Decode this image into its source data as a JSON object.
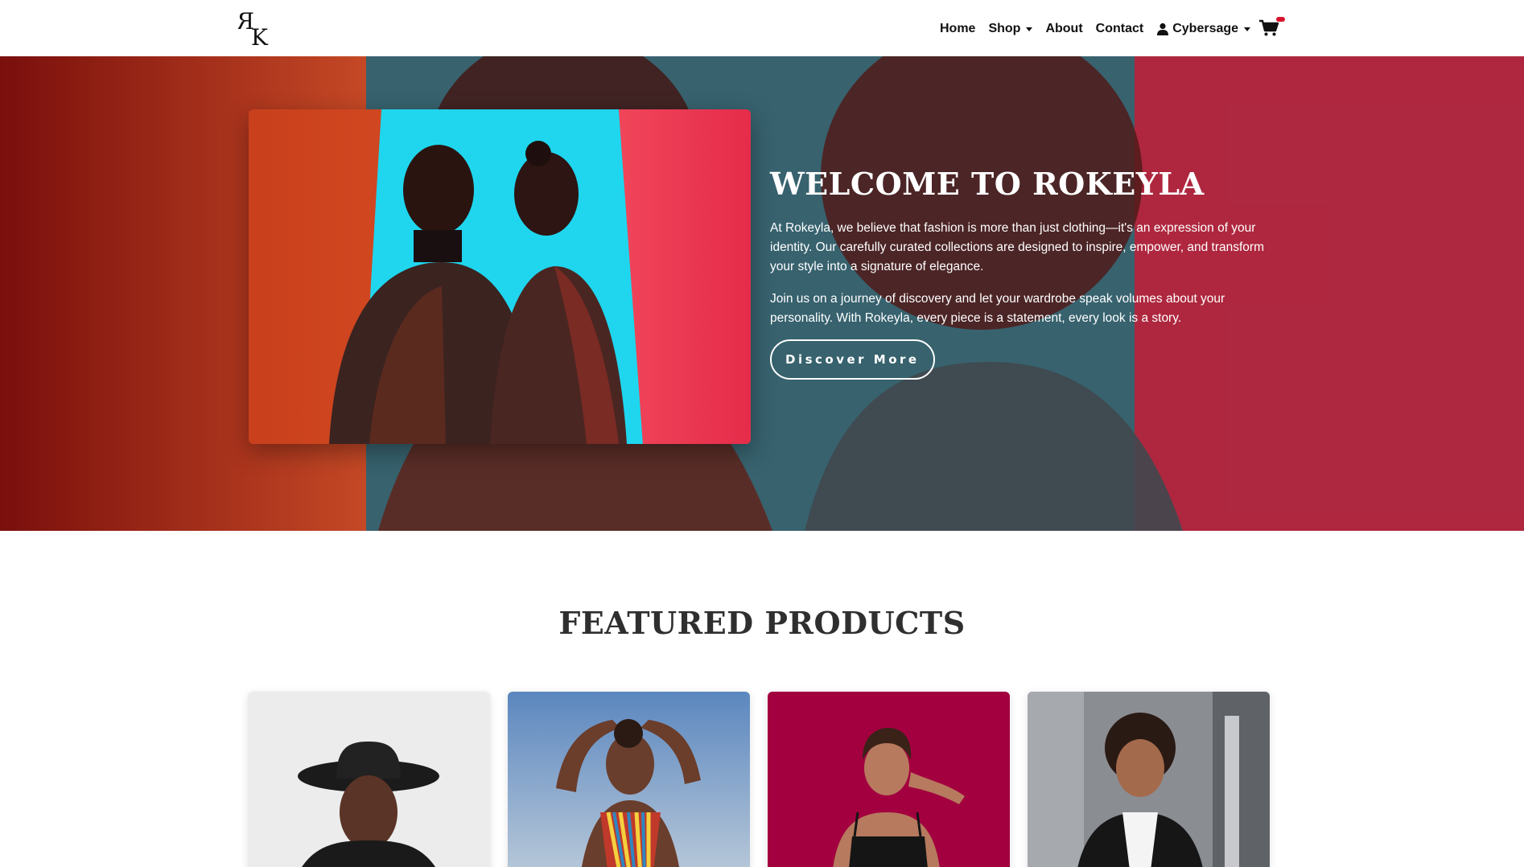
{
  "nav": {
    "logo_alt": "RK",
    "links": [
      {
        "label": "Home"
      },
      {
        "label": "Shop",
        "dropdown": true
      },
      {
        "label": "About"
      },
      {
        "label": "Contact"
      }
    ],
    "user": {
      "label": "Cybersage",
      "icon": "user-icon"
    },
    "cart_icon": "cart-icon",
    "accent": "#d8142b"
  },
  "hero": {
    "title": "WELCOME TO ROKEYLA",
    "paragraph1": "At Rokeyla, we believe that fashion is more than just clothing—it's an expression of your identity. Our carefully curated collections are designed to inspire, empower, and transform your style into a signature of elegance.",
    "paragraph2": "Join us on a journey of discovery and let your wardrobe speak volumes about your personality. With Rokeyla, every piece is a statement, every look is a story.",
    "button_label": "Discover More"
  },
  "featured": {
    "title": "FEATURED PRODUCTS",
    "products": [
      {
        "name": "product-man-in-hat",
        "bg": "#ececec"
      },
      {
        "name": "product-woman-beaded",
        "bg": "#6f9ac8"
      },
      {
        "name": "product-woman-black-top",
        "bg": "#a3003f"
      },
      {
        "name": "product-woman-blazer",
        "bg": "#8a8d92"
      }
    ]
  }
}
